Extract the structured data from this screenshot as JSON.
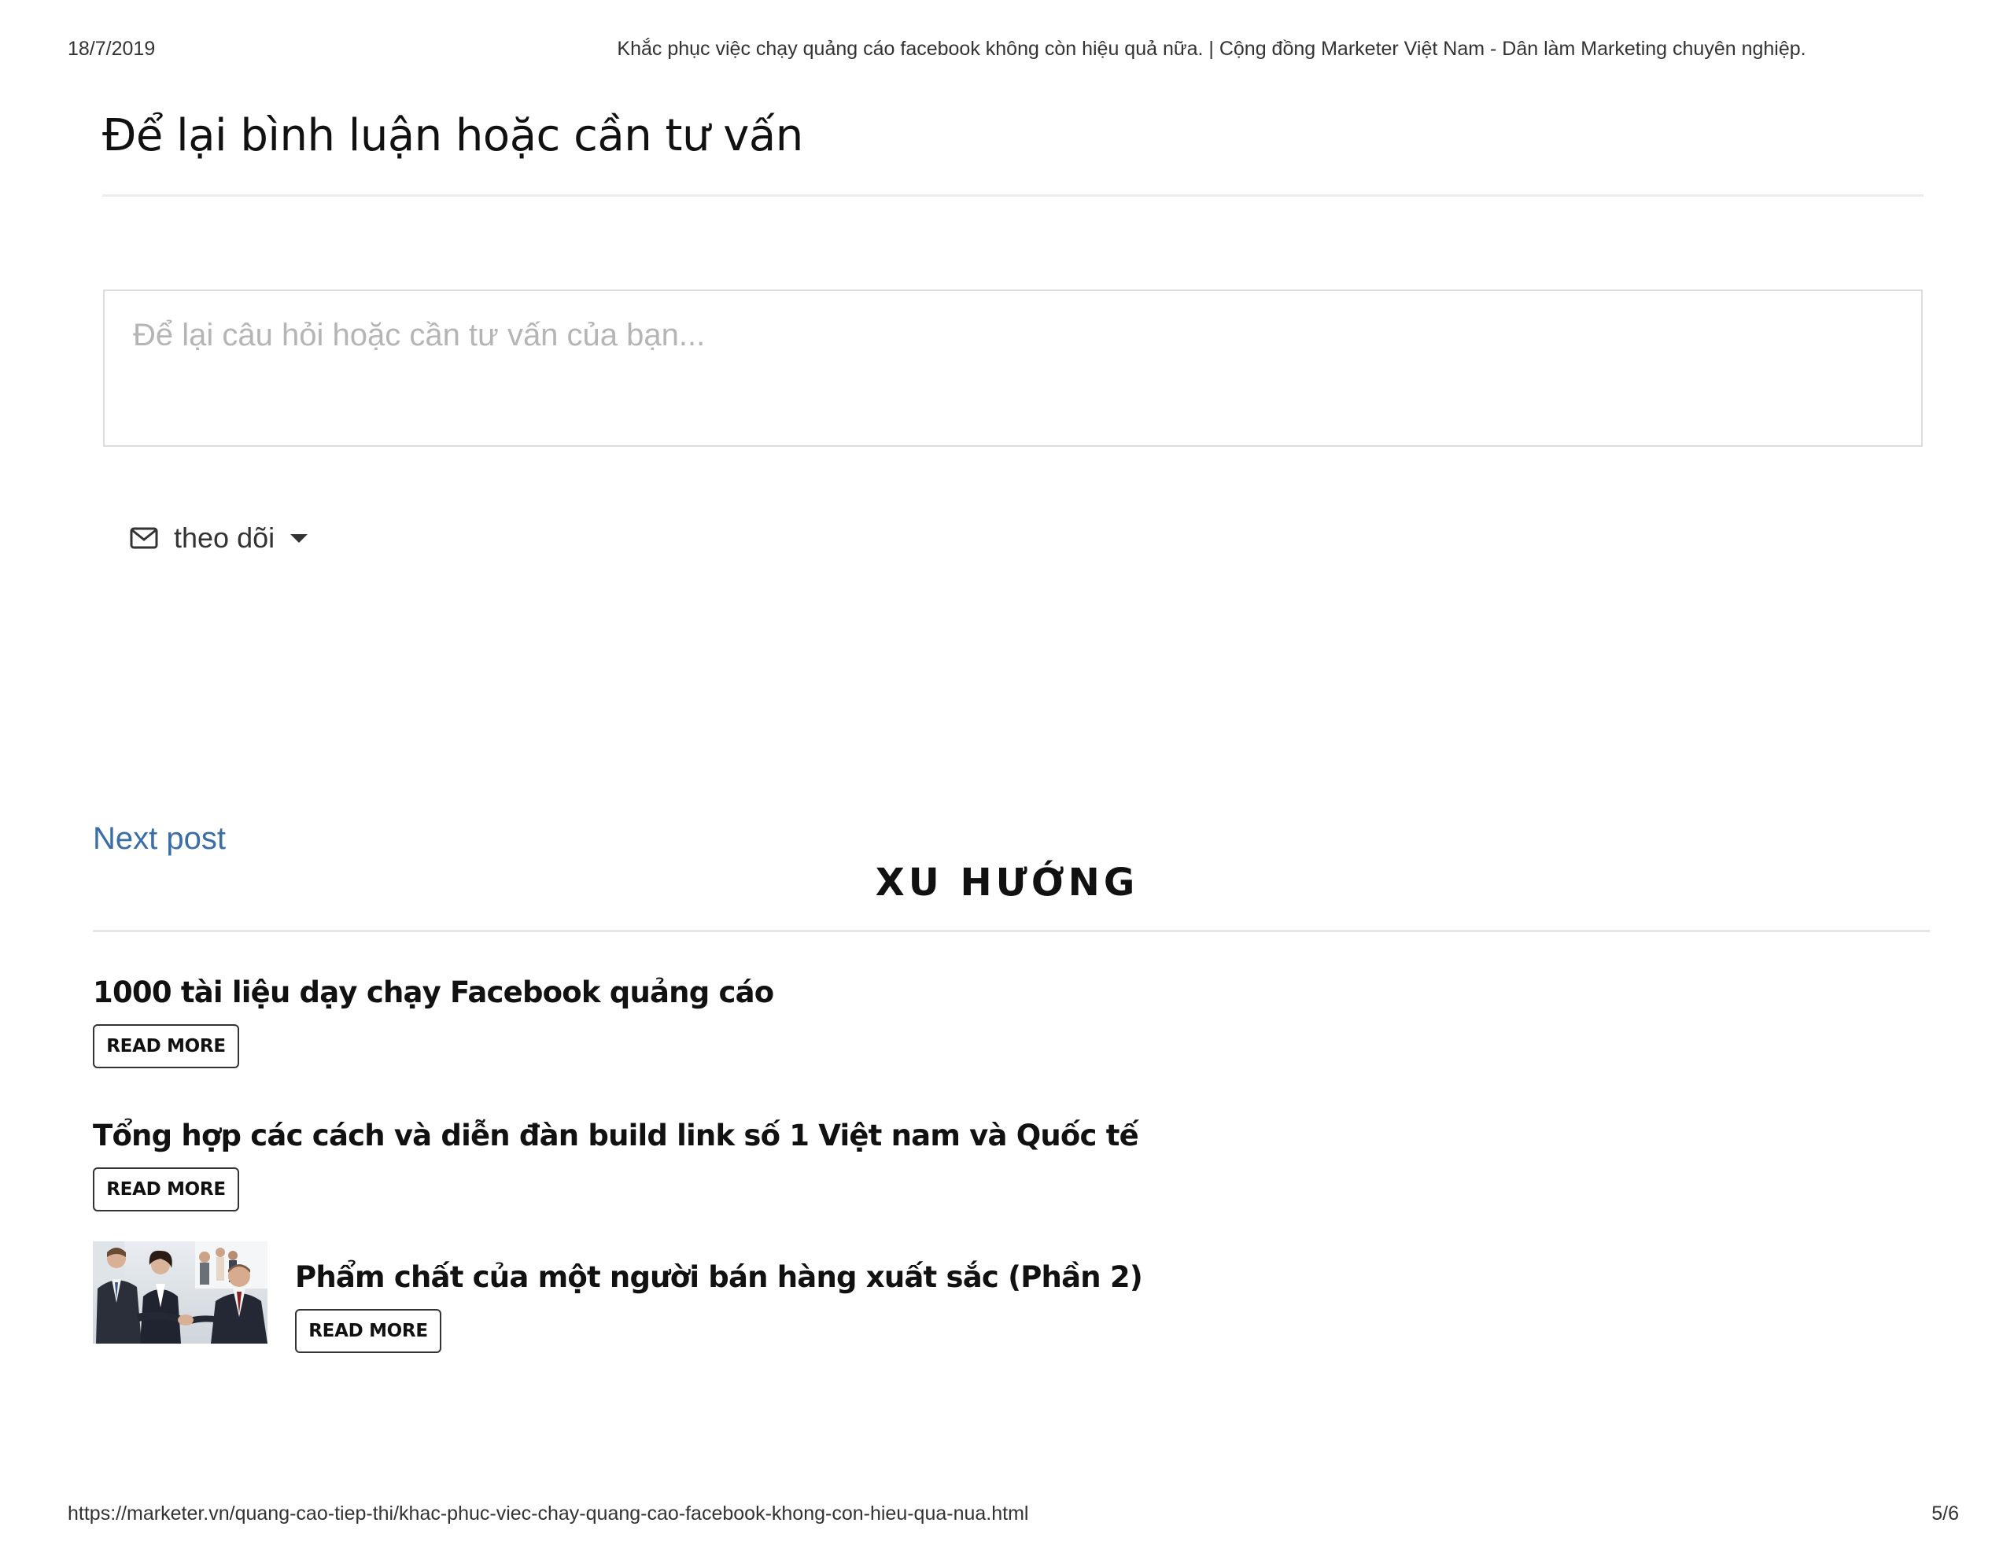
{
  "print_header": {
    "date": "18/7/2019",
    "title": "Khắc phục việc chạy quảng cáo facebook không còn hiệu quả nữa. | Cộng đồng Marketer Việt Nam - Dân làm Marketing chuyên nghiệp."
  },
  "comments": {
    "heading": "Để lại bình luận hoặc cần tư vấn",
    "placeholder": "Để lại câu hỏi hoặc cần tư vấn của bạn...",
    "subscribe_label": "theo dõi",
    "subscribe_icon": "envelope-icon",
    "dropdown_icon": "caret-down-icon"
  },
  "navigation": {
    "next_post": "Next post"
  },
  "trending": {
    "heading": "XU HƯỚNG",
    "posts": [
      {
        "title": "1000 tài liệu dạy chạy Facebook quảng cáo",
        "button": "READ MORE"
      },
      {
        "title": "Tổng hợp các cách và diễn đàn build link số 1 Việt nam và Quốc tế",
        "button": "READ MORE"
      },
      {
        "title": "Phẩm chất của một người bán hàng xuất sắc (Phần 2)",
        "button": "READ MORE",
        "thumbnail": "business-handshake-photo"
      }
    ]
  },
  "print_footer": {
    "url": "https://marketer.vn/quang-cao-tiep-thi/khac-phuc-viec-chay-quang-cao-facebook-khong-con-hieu-qua-nua.html",
    "page": "5/6"
  },
  "colors": {
    "link": "#3a6ea5",
    "text": "#111111",
    "placeholder": "#b5b5b5",
    "border": "#dddddd"
  }
}
